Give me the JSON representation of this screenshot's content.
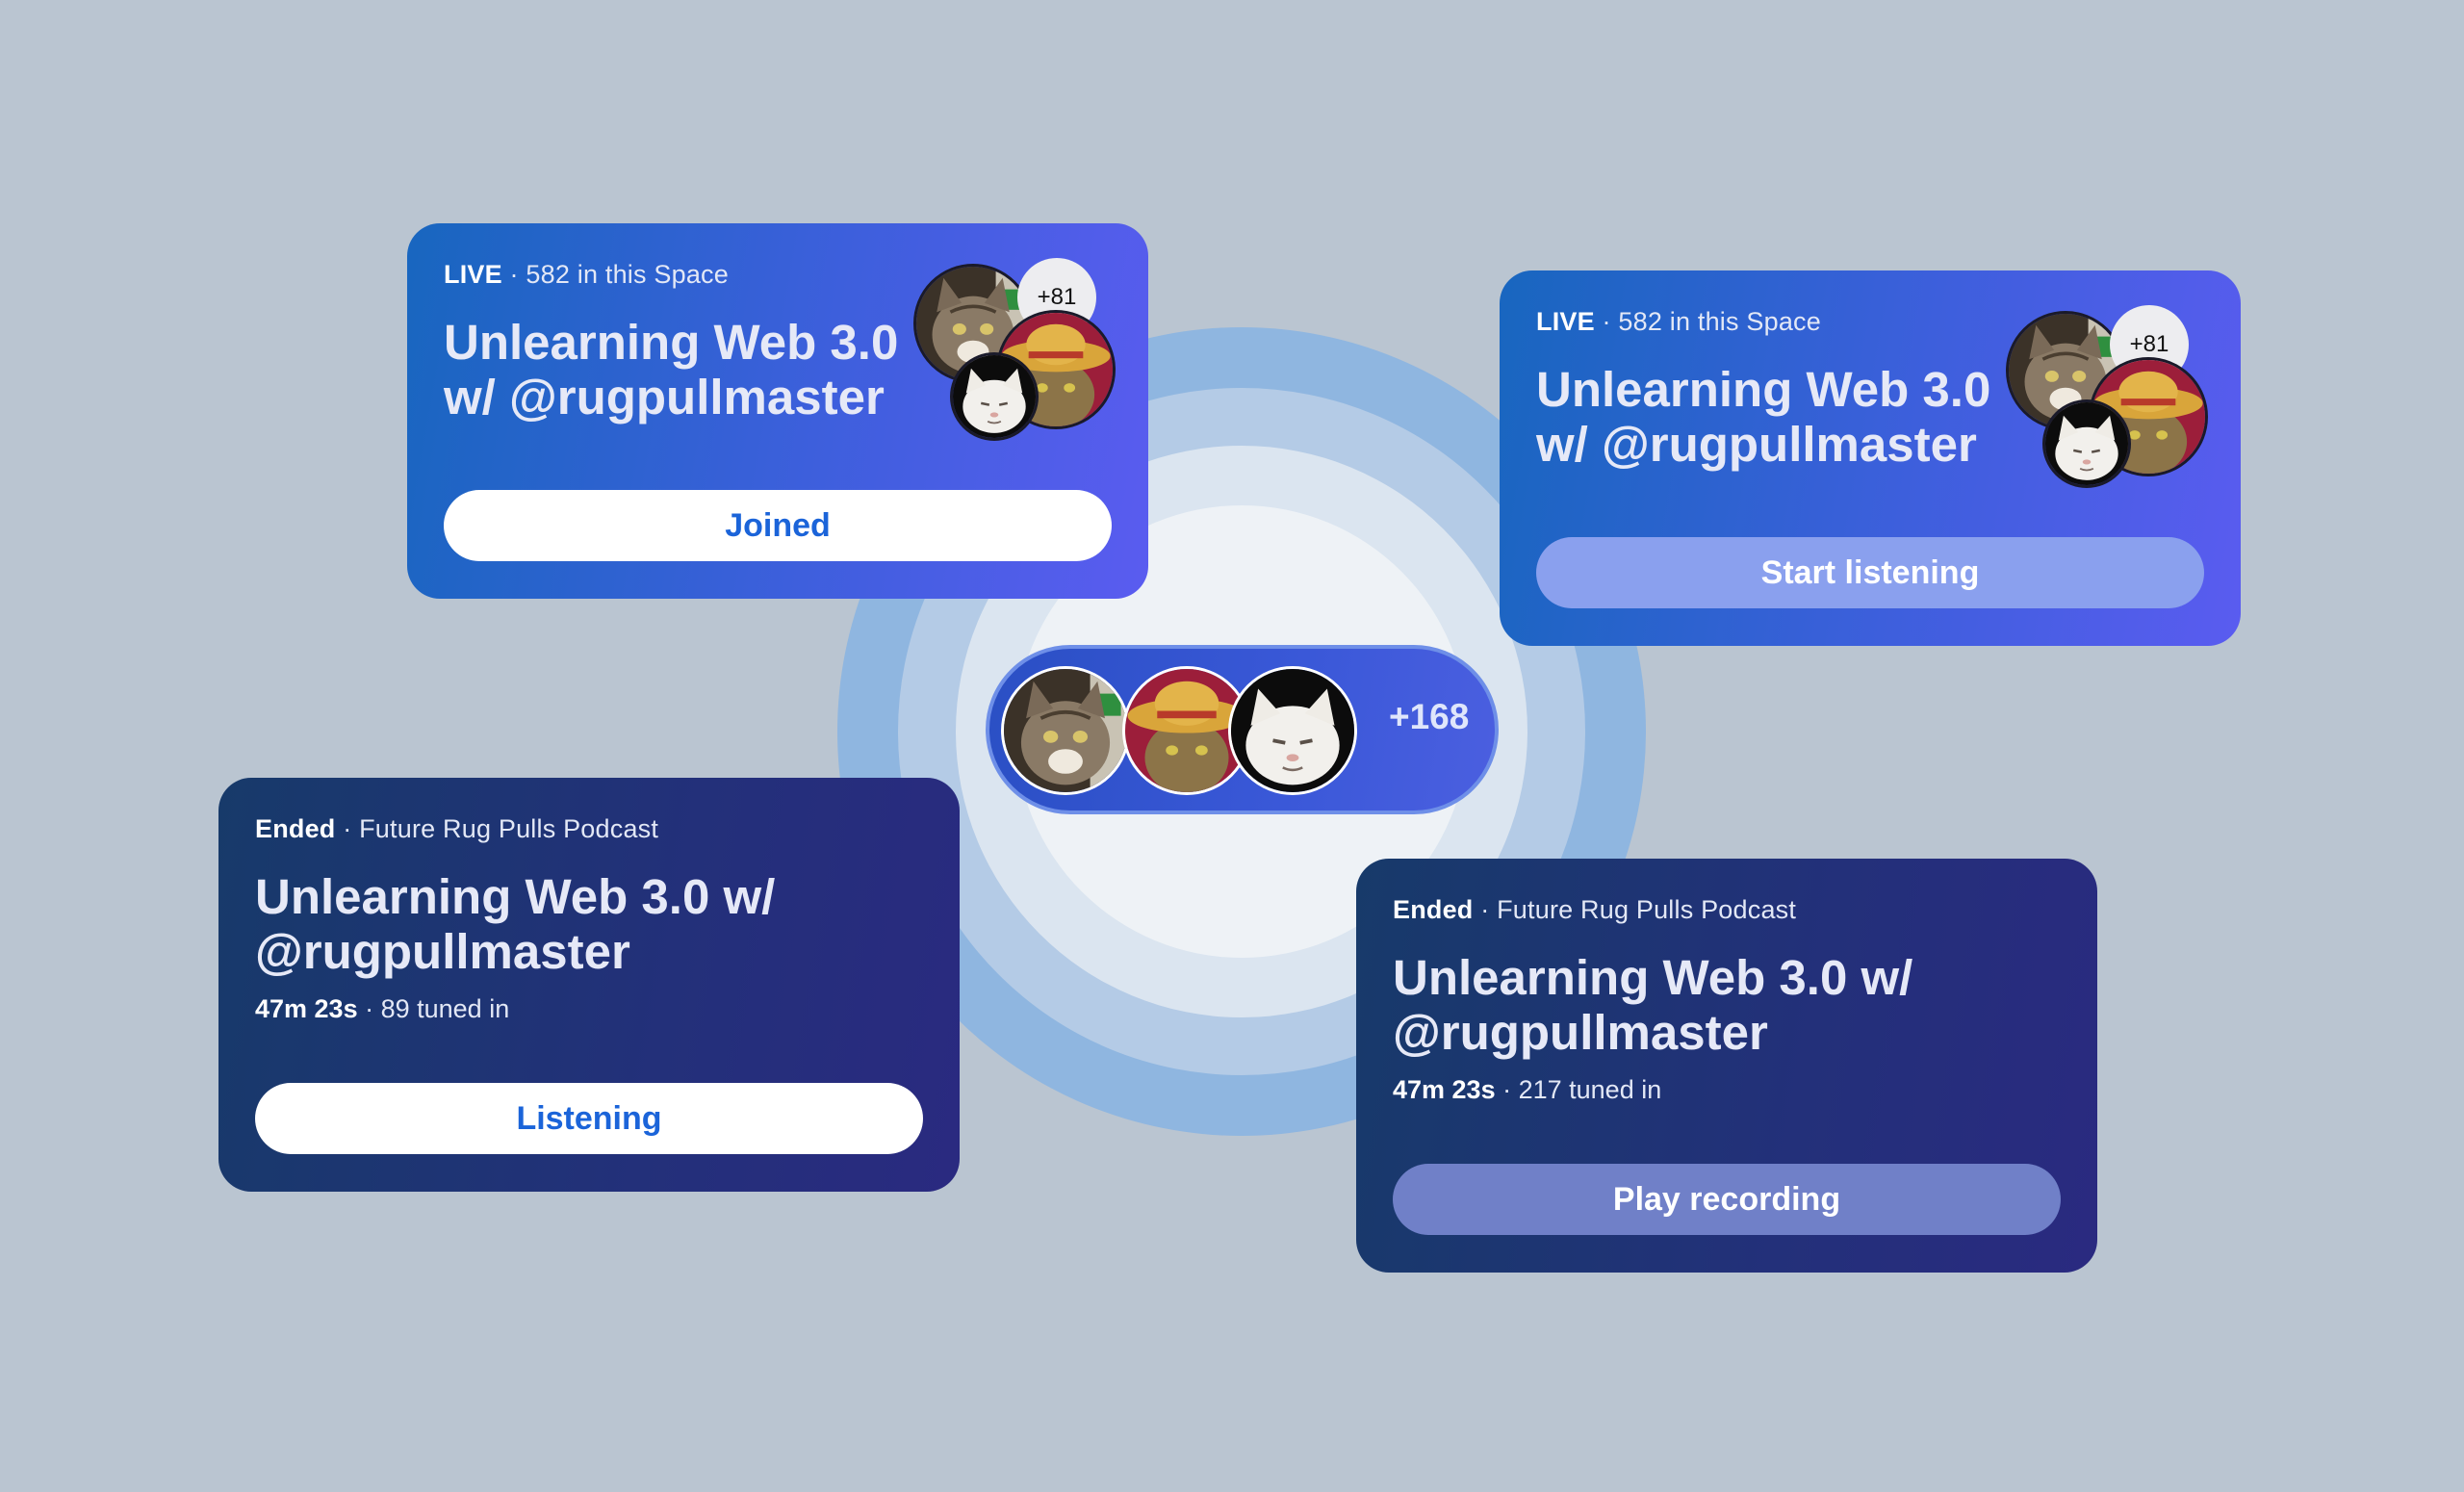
{
  "colors": {
    "background": "#bac5d1",
    "live_card_gradient_start": "#1866bf",
    "live_card_gradient_end": "#5a5cf0",
    "ended_card_gradient_start": "#173a6a",
    "ended_card_gradient_end": "#2a2a80",
    "accent_blue": "#1b64d9",
    "ring_outer": "#8fb6e0",
    "ring_middle": "#b4cbe6",
    "ring_inner": "#dbe5f0",
    "ring_center": "#eef2f6"
  },
  "cards": [
    {
      "status": "LIVE",
      "meta": "· 582 in this Space",
      "title": "Unlearning Web 3.0 w/ @rugpullmaster",
      "avatar_count": "+81",
      "button": "Joined"
    },
    {
      "status": "LIVE",
      "meta": "· 582 in this Space",
      "title": "Unlearning Web 3.0 w/ @rugpullmaster",
      "avatar_count": "+81",
      "button": "Start listening"
    },
    {
      "status": "Ended",
      "meta": "· Future Rug Pulls Podcast",
      "title": "Unlearning Web 3.0 w/ @rugpullmaster",
      "duration": "47m 23s",
      "listeners": "· 89 tuned in",
      "button": "Listening"
    },
    {
      "status": "Ended",
      "meta": "· Future Rug Pulls Podcast",
      "title": "Unlearning Web 3.0 w/ @rugpullmaster",
      "duration": "47m 23s",
      "listeners": "· 217 tuned in",
      "button": "Play recording"
    }
  ],
  "center_pill": {
    "count": "+168",
    "avatars": [
      "tabby-cat-avatar",
      "straw-hat-cat-avatar",
      "white-cat-avatar"
    ]
  }
}
